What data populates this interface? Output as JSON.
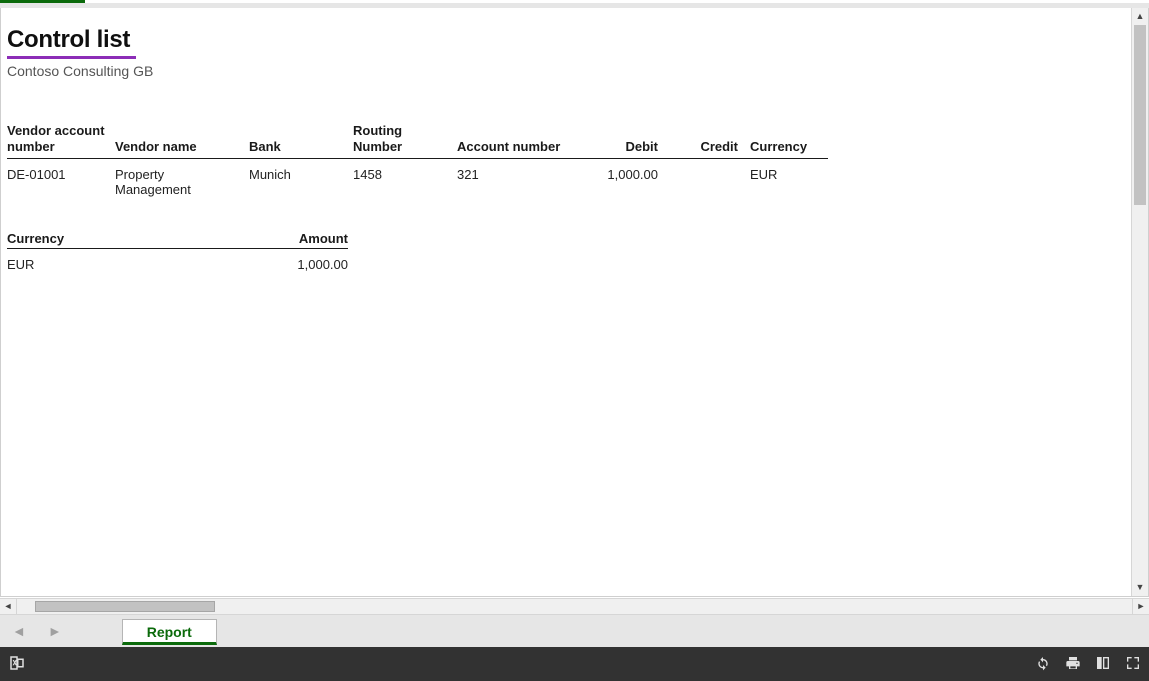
{
  "title": "Control list",
  "subtitle": "Contoso Consulting GB",
  "main_table": {
    "headers": {
      "vendor_account": "Vendor account number",
      "vendor_name": "Vendor name",
      "bank": "Bank",
      "routing": "Routing Number",
      "account_no": "Account number",
      "debit": "Debit",
      "credit": "Credit",
      "currency": "Currency"
    },
    "rows": [
      {
        "vendor_account": "DE-01001",
        "vendor_name": "Property Management",
        "bank": "Munich",
        "routing": "1458",
        "account_no": "321",
        "debit": "1,000.00",
        "credit": "",
        "currency": "EUR"
      }
    ]
  },
  "summary_table": {
    "headers": {
      "currency": "Currency",
      "amount": "Amount"
    },
    "rows": [
      {
        "currency": "EUR",
        "amount": "1,000.00"
      }
    ]
  },
  "sheet_tab": "Report"
}
